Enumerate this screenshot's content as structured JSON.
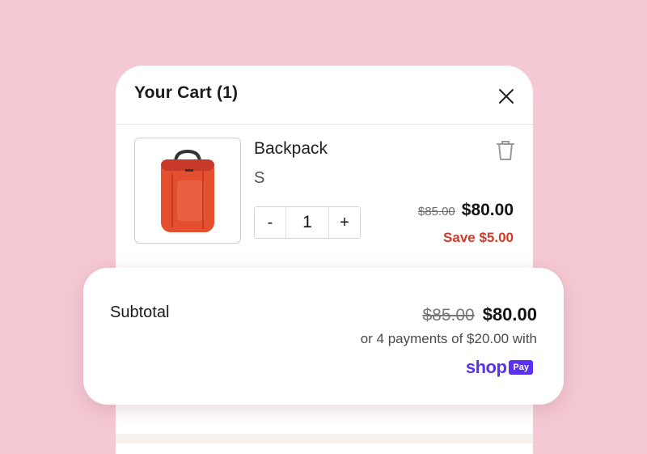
{
  "cart": {
    "title": "Your Cart (1)",
    "close_icon": "close-icon"
  },
  "item": {
    "name": "Backpack",
    "variant": "S",
    "quantity": "1",
    "decrement_label": "-",
    "increment_label": "+",
    "compare_price": "$85.00",
    "price": "$80.00",
    "savings": "Save $5.00",
    "delete_icon": "trash-icon",
    "image_icon": "backpack-icon"
  },
  "subtotal": {
    "label": "Subtotal",
    "compare_price": "$85.00",
    "price": "$80.00",
    "installments": "or 4 payments of $20.00 with",
    "shop_word": "shop",
    "pay_word": "Pay"
  },
  "colors": {
    "background": "#f5c9d3",
    "savings": "#d23b2a",
    "shop_pay": "#5a31f4",
    "product": "#e44f2f"
  }
}
